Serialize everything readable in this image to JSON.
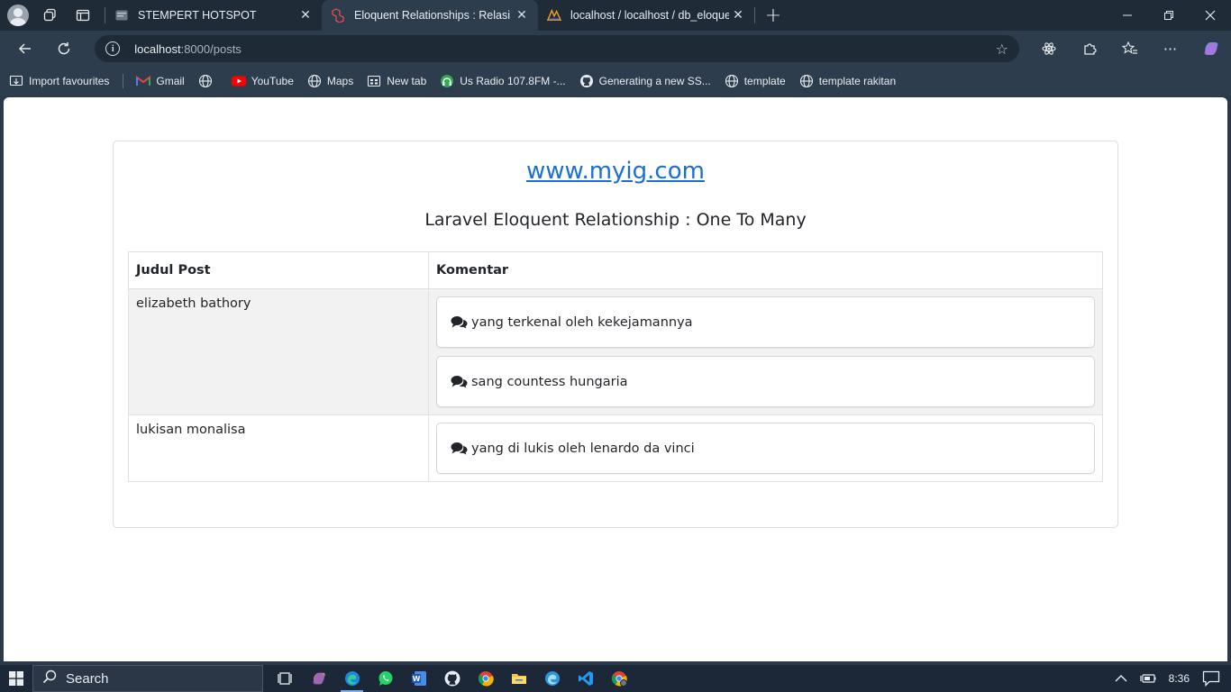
{
  "tabs": [
    {
      "title": "STEMPERT HOTSPOT",
      "favicon": "hotspot-icon",
      "active": false
    },
    {
      "title": "Eloquent Relationships : Relasi One",
      "favicon": "laravel-icon",
      "active": true
    },
    {
      "title": "localhost / localhost / db_eloquent",
      "favicon": "phpmyadmin-icon",
      "active": false
    }
  ],
  "addressbar": {
    "host": "localhost",
    "path": ":8000/posts"
  },
  "favourites": [
    {
      "label": "Import favourites",
      "icon": "import-icon"
    },
    {
      "label": "Gmail",
      "icon": "gmail-icon"
    },
    {
      "label": "",
      "icon": "globe-icon"
    },
    {
      "label": "YouTube",
      "icon": "youtube-icon"
    },
    {
      "label": "Maps",
      "icon": "globe-icon"
    },
    {
      "label": "New tab",
      "icon": "newtab-icon"
    },
    {
      "label": "Us Radio 107.8FM -...",
      "icon": "radio-icon"
    },
    {
      "label": "Generating a new SS...",
      "icon": "github-icon"
    },
    {
      "label": "template",
      "icon": "globe-icon"
    },
    {
      "label": "template rakitan",
      "icon": "globe-icon"
    }
  ],
  "page": {
    "site_link": "www.myig.com",
    "heading": "Laravel Eloquent Relationship : One To Many",
    "table": {
      "headers": [
        "Judul Post",
        "Komentar"
      ],
      "rows": [
        {
          "title": "elizabeth bathory",
          "comments": [
            "yang terkenal oleh kekejamannya",
            "sang countess hungaria"
          ]
        },
        {
          "title": "lukisan monalisa",
          "comments": [
            "yang di lukis oleh lenardo da vinci"
          ]
        }
      ]
    }
  },
  "taskbar": {
    "search_placeholder": "Search",
    "clock": "8:36"
  },
  "colors": {
    "link": "#1a6fd6",
    "tab_bg": "#202b38",
    "toolbar_bg": "#2e3d4e"
  }
}
